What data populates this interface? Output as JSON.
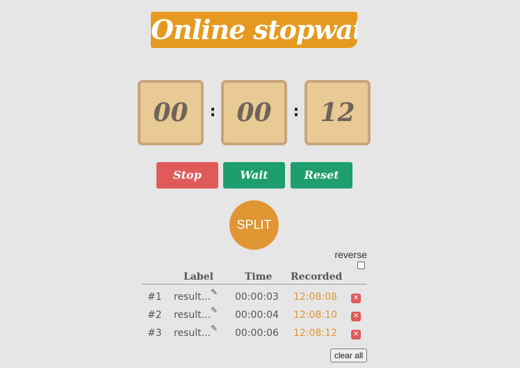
{
  "header": {
    "title": "Online stopwatch"
  },
  "timer": {
    "hours": "00",
    "minutes": "00",
    "seconds": "12",
    "separator": ":"
  },
  "controls": {
    "stop_label": "Stop",
    "wait_label": "Wait",
    "reset_label": "Reset",
    "split_label": "SPLIT"
  },
  "options": {
    "reverse_label": "reverse",
    "reverse_checked": false
  },
  "table": {
    "headers": {
      "label": "Label",
      "time": "Time",
      "recorded": "Recorded"
    },
    "rows": [
      {
        "num": "#1",
        "label": "result...",
        "time": "00:00:03",
        "recorded": "12:08:08"
      },
      {
        "num": "#2",
        "label": "result...",
        "time": "00:00:04",
        "recorded": "12:08:10"
      },
      {
        "num": "#3",
        "label": "result...",
        "time": "00:00:06",
        "recorded": "12:08:12"
      }
    ]
  },
  "footer": {
    "clear_all_label": "clear all"
  },
  "icons": {
    "edit": "pencil-icon",
    "delete": "close-icon"
  },
  "colors": {
    "accent": "#e59a1f",
    "stop": "#e05a5a",
    "go": "#1e9e6e",
    "split": "#df9633",
    "digit_bg": "#e9c994"
  }
}
